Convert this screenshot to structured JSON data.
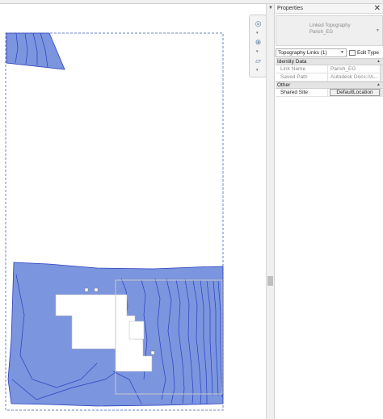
{
  "properties_panel": {
    "title": "Properties",
    "close_symbol": "✕",
    "type_selector": {
      "family": "Linked Topography",
      "type": "Parish_EG"
    },
    "filter": {
      "selected": "Topography Links (1)"
    },
    "edit_type_label": "Edit Type",
    "categories": [
      {
        "name": "Identity Data",
        "rows": [
          {
            "label": "Link Name",
            "value": "Parish_EG"
          },
          {
            "label": "Saved Path",
            "value": "Autodesk Docs://A..."
          }
        ]
      },
      {
        "name": "Other",
        "rows": [
          {
            "label": "Shared Site",
            "value": "DefaultLocation"
          }
        ]
      }
    ]
  },
  "navigation_bar": {
    "buttons": [
      "steering-wheel",
      "zoom",
      "orient"
    ]
  },
  "colors": {
    "topography_fill": "#7b95de",
    "contour_line": "#2a3fbf",
    "crop_boundary": "#6b86c4",
    "panel_header": "#f5f5f5"
  }
}
